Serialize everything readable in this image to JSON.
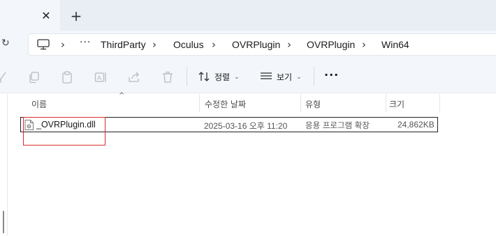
{
  "tabs": {
    "close_glyph": "✕",
    "new_tab_glyph": "+"
  },
  "address": {
    "refresh_glyph": "↻",
    "overflow_glyph": "···",
    "separator_glyph": "›",
    "crumbs": [
      "ThirdParty",
      "Oculus",
      "OVRPlugin",
      "OVRPlugin",
      "Win64"
    ]
  },
  "toolbar": {
    "sort_label": "정렬",
    "view_label": "보기",
    "more_glyph": "···",
    "icons": [
      "cut-icon",
      "copy-icon",
      "paste-icon",
      "rename-icon",
      "share-icon",
      "delete-icon"
    ]
  },
  "columns": {
    "name": "이름",
    "modified": "수정한 날짜",
    "type": "유형",
    "size": "크기"
  },
  "files": [
    {
      "name": "_OVRPlugin.dll",
      "modified": "2025-03-16 오후 11:20",
      "type": "응용 프로그램 확장",
      "size": "24,862KB"
    }
  ],
  "colors": {
    "chrome_bg": "#f3f6fb",
    "tabstrip_bg": "#e9eef5",
    "highlight": "#d92b2b"
  }
}
